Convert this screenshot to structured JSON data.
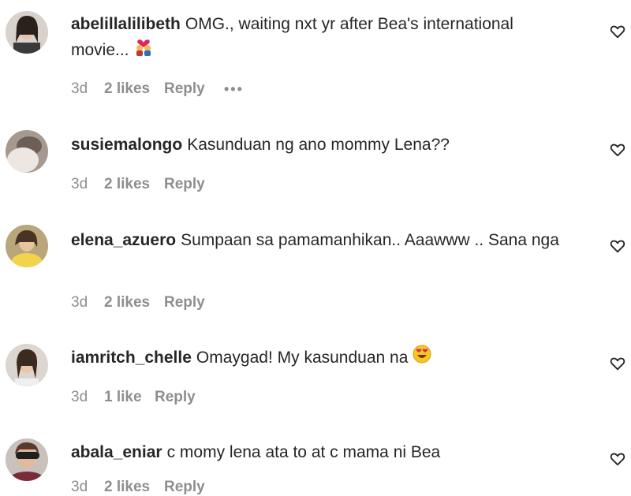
{
  "comments": [
    {
      "username": "abelillalilibeth",
      "text": "OMG., waiting nxt yr after Bea's international movie...",
      "emoji": "couple-heart",
      "time": "3d",
      "likes": "2 likes",
      "reply": "Reply",
      "more": "•••"
    },
    {
      "username": "susiemalongo",
      "text": "Kasunduan ng ano mommy Lena??",
      "emoji": "",
      "time": "3d",
      "likes": "2 likes",
      "reply": "Reply",
      "more": ""
    },
    {
      "username": "elena_azuero",
      "text": "Sumpaan sa pamamanhikan.. Aaawww .. Sana nga",
      "emoji": "",
      "time": "3d",
      "likes": "2 likes",
      "reply": "Reply",
      "more": ""
    },
    {
      "username": "iamritch_chelle",
      "text": "Omaygad! My kasunduan na",
      "emoji": "heart-eyes",
      "time": "3d",
      "likes": "1 like",
      "reply": "Reply",
      "more": ""
    },
    {
      "username": "abala_eniar",
      "text": "c momy lena ata to at c mama ni Bea",
      "emoji": "",
      "time": "3d",
      "likes": "2 likes",
      "reply": "Reply",
      "more": ""
    }
  ],
  "icons": {
    "like": "heart-outline-icon",
    "more": "more-options-icon"
  },
  "colors": {
    "text": "#262626",
    "secondary": "#8e8e8e"
  }
}
